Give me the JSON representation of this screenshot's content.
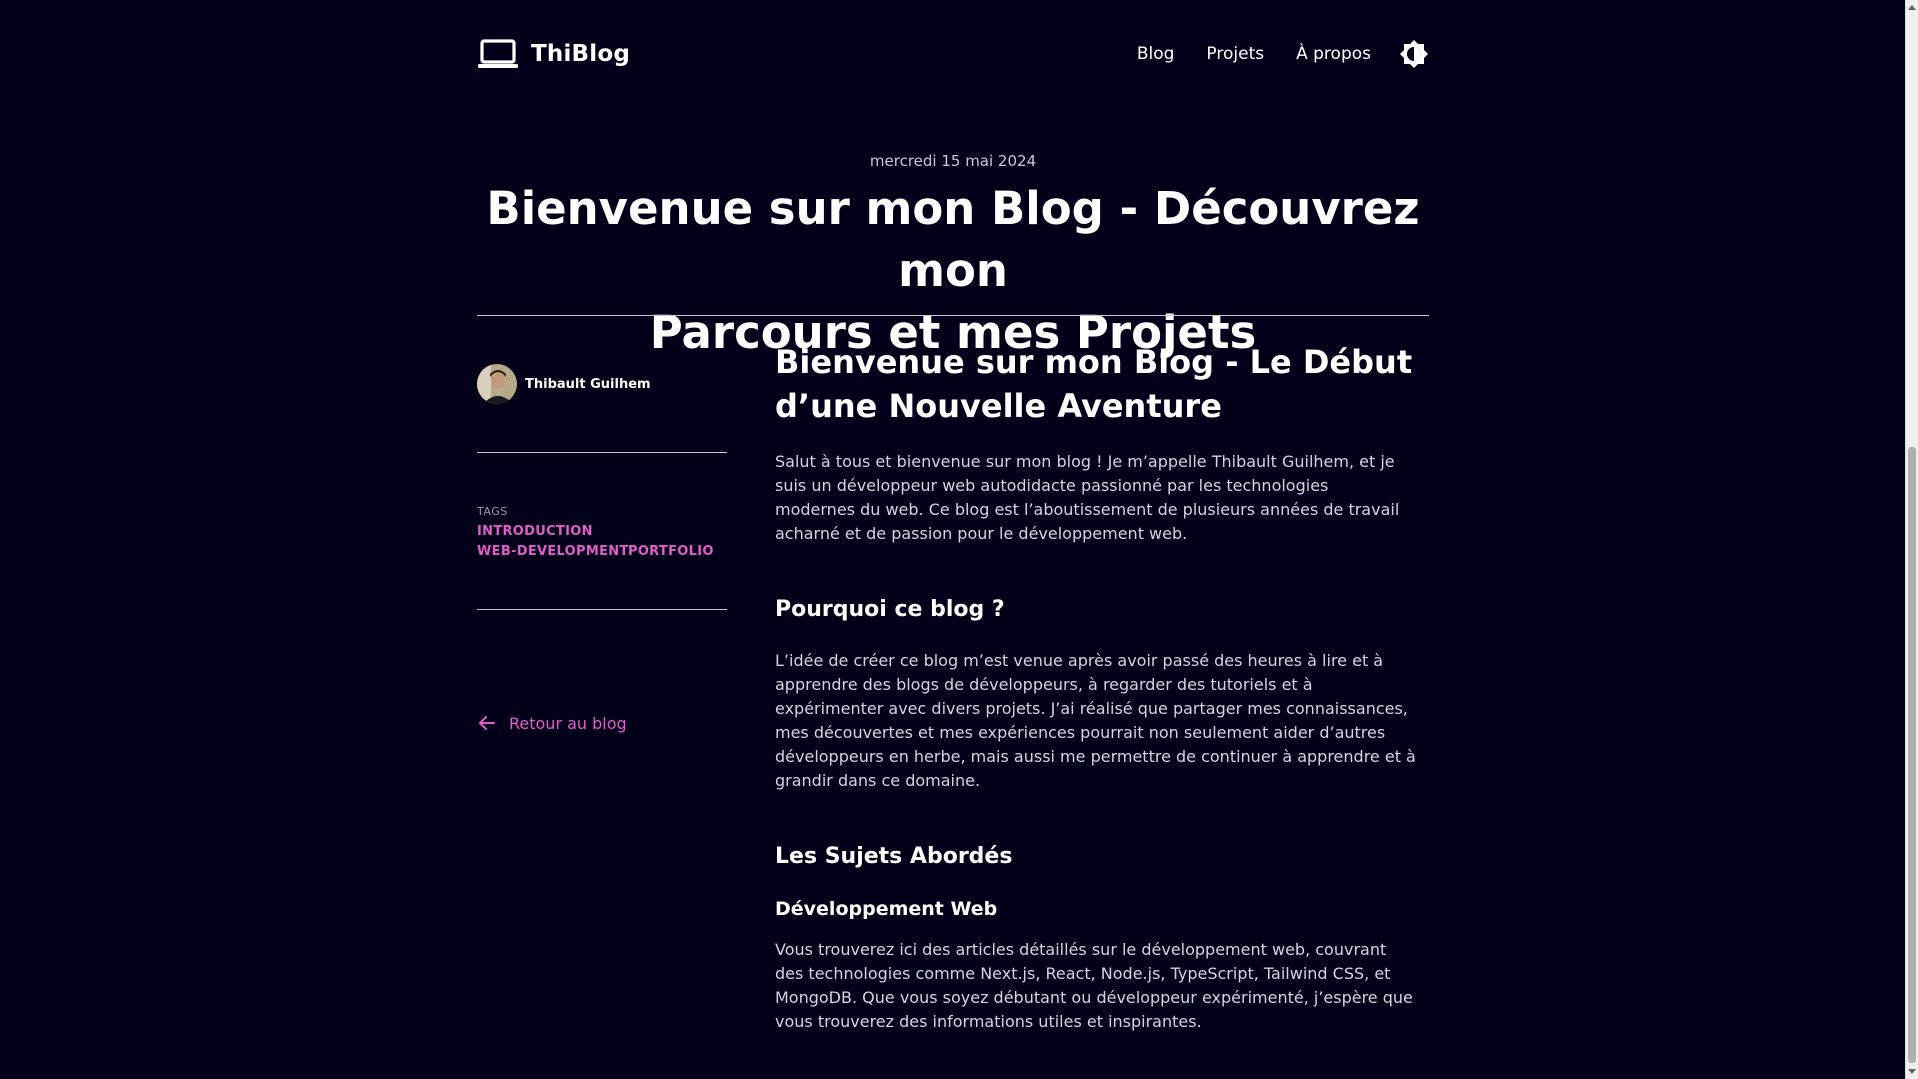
{
  "header": {
    "logo_text": "ThiBlog",
    "logo_icon": "laptop-icon",
    "nav": [
      {
        "label": "Blog"
      },
      {
        "label": "Projets"
      },
      {
        "label": "À propos"
      }
    ],
    "theme_toggle_icon": "theme-toggle-icon"
  },
  "post": {
    "date": "mercredi 15 mai 2024",
    "title_line1": "Bienvenue sur mon Blog - Découvrez mon",
    "title_line2": "Parcours et mes Projets"
  },
  "sidebar": {
    "author_name": "Thibault Guilhem",
    "tags_label": "TAGS",
    "tags": [
      "INTRODUCTION",
      "WEB-DEVELOPMENT",
      "PORTFOLIO"
    ],
    "back_link": "Retour au blog"
  },
  "content": {
    "h1_line1": "Bienvenue sur mon Blog - Le Début",
    "h1_line2": "d’une Nouvelle Aventure",
    "intro": [
      "Salut à tous et bienvenue sur mon blog ! Je m’appelle Thibault Guilhem, et je",
      "suis un développeur web autodidacte passionné par les technologies",
      "modernes du web. Ce blog est l’aboutissement de plusieurs années de travail",
      "acharné et de passion pour le développement web."
    ],
    "why_heading": "Pourquoi ce blog ?",
    "why_text": [
      "L’idée de créer ce blog m’est venue après avoir passé des heures à lire et à",
      "apprendre des blogs de développeurs, à regarder des tutoriels et à",
      "expérimenter avec divers projets. J’ai réalisé que partager mes connaissances,",
      "mes découvertes et mes expériences pourrait non seulement aider d’autres",
      "développeurs en herbe, mais aussi me permettre de continuer à apprendre et à",
      "grandir dans ce domaine."
    ],
    "topics_heading": "Les Sujets Abordés",
    "webdev_heading": "Développement Web",
    "webdev_text": [
      "Vous trouverez ici des articles détaillés sur le développement web, couvrant",
      "des technologies comme Next.js, React, Node.js, TypeScript, Tailwind CSS, et",
      "MongoDB. Que vous soyez débutant ou développeur expérimenté, j’espère que",
      "vous trouverez des informations utiles et inspirantes."
    ]
  },
  "colors": {
    "background": "#03001a",
    "accent": "#e25ec7",
    "text": "#ffffff"
  }
}
